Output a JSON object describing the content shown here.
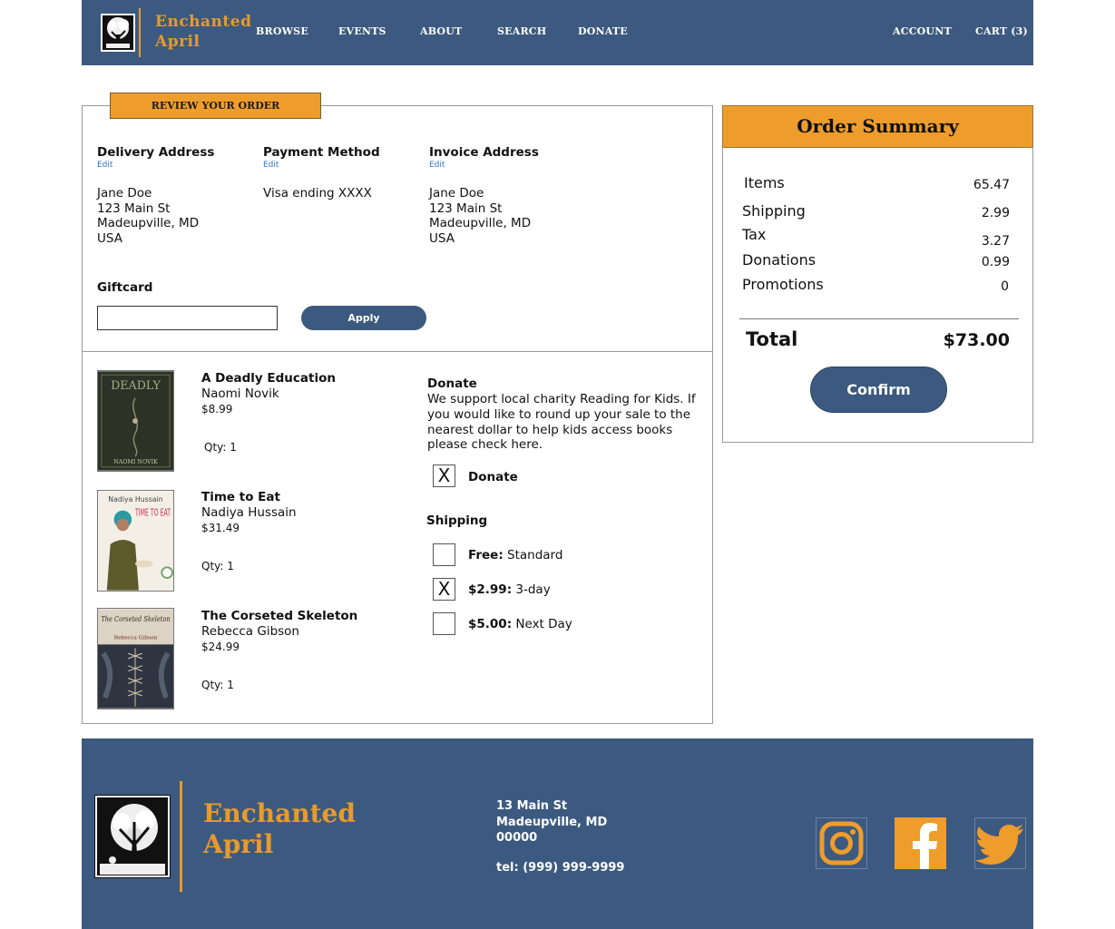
{
  "header": {
    "brand_line1": "Enchanted",
    "brand_line2": "April",
    "nav": [
      "BROWSE",
      "EVENTS",
      "ABOUT",
      "SEARCH",
      "DONATE"
    ],
    "account": "ACCOUNT",
    "cart": "CART (3)"
  },
  "review": {
    "tab_label": "REVIEW YOUR ORDER",
    "delivery": {
      "heading": "Delivery Address",
      "edit": "Edit",
      "lines": [
        "Jane Doe",
        "123 Main St",
        "Madeupville, MD",
        "USA"
      ]
    },
    "payment": {
      "heading": "Payment Method",
      "edit": "Edit",
      "lines": [
        "Visa ending XXXX"
      ]
    },
    "invoice": {
      "heading": "Invoice  Address",
      "edit": "Edit",
      "lines": [
        "Jane Doe",
        "123 Main St",
        "Madeupville, MD",
        "USA"
      ]
    },
    "giftcard": {
      "label": "Giftcard",
      "value": "",
      "apply_label": "Apply"
    }
  },
  "books": [
    {
      "title": "A Deadly Education",
      "author": "Naomi Novik",
      "price": "$8.99",
      "qty": "Qty: 1",
      "cover_title": "DEADLY",
      "cover_author": "NAOMI NOVIK"
    },
    {
      "title": "Time to Eat",
      "author": "Nadiya Hussain",
      "price": "$31.49",
      "qty": "Qty: 1",
      "cover_title": "TIME TO EAT",
      "cover_author": "Nadiya Hussain"
    },
    {
      "title": "The Corseted Skeleton",
      "author": "Rebecca Gibson",
      "price": "$24.99",
      "qty": "Qty: 1",
      "cover_title": "The Corseted Skeleton",
      "cover_author": "Rebecca Gibson"
    }
  ],
  "donate": {
    "title": "Donate",
    "text": "We support local charity Reading for Kids. If you would like to round up your sale to the nearest dollar to help kids access books please check here.",
    "checkbox_label": "Donate",
    "checked": true
  },
  "shipping": {
    "title": "Shipping",
    "options": [
      {
        "price": "Free:",
        "desc": " Standard",
        "checked": false
      },
      {
        "price": "$2.99:",
        "desc": " 3-day",
        "checked": true
      },
      {
        "price": "$5.00:",
        "desc": " Next Day",
        "checked": false
      }
    ],
    "check_mark": "X"
  },
  "summary": {
    "title": "Order Summary",
    "rows": [
      {
        "label": "Items",
        "value": "65.47"
      },
      {
        "label": "Shipping",
        "value": "2.99"
      },
      {
        "label": "Tax",
        "value": "3.27"
      },
      {
        "label": "Donations",
        "value": "0.99"
      },
      {
        "label": "Promotions",
        "value": "0"
      }
    ],
    "total_label": "Total",
    "total_value": "$73.00",
    "confirm_label": "Confirm"
  },
  "footer": {
    "brand_line1": "Enchanted",
    "brand_line2": "April",
    "address_lines": [
      "13 Main St",
      "Madeupville, MD",
      "00000"
    ],
    "tel": "tel: (999) 999-9999",
    "social_icons": [
      "instagram-icon",
      "facebook-icon",
      "twitter-icon"
    ]
  },
  "colors": {
    "navy": "#3c5a80",
    "orange": "#ee9c2b",
    "link_blue": "#2f74d0"
  }
}
